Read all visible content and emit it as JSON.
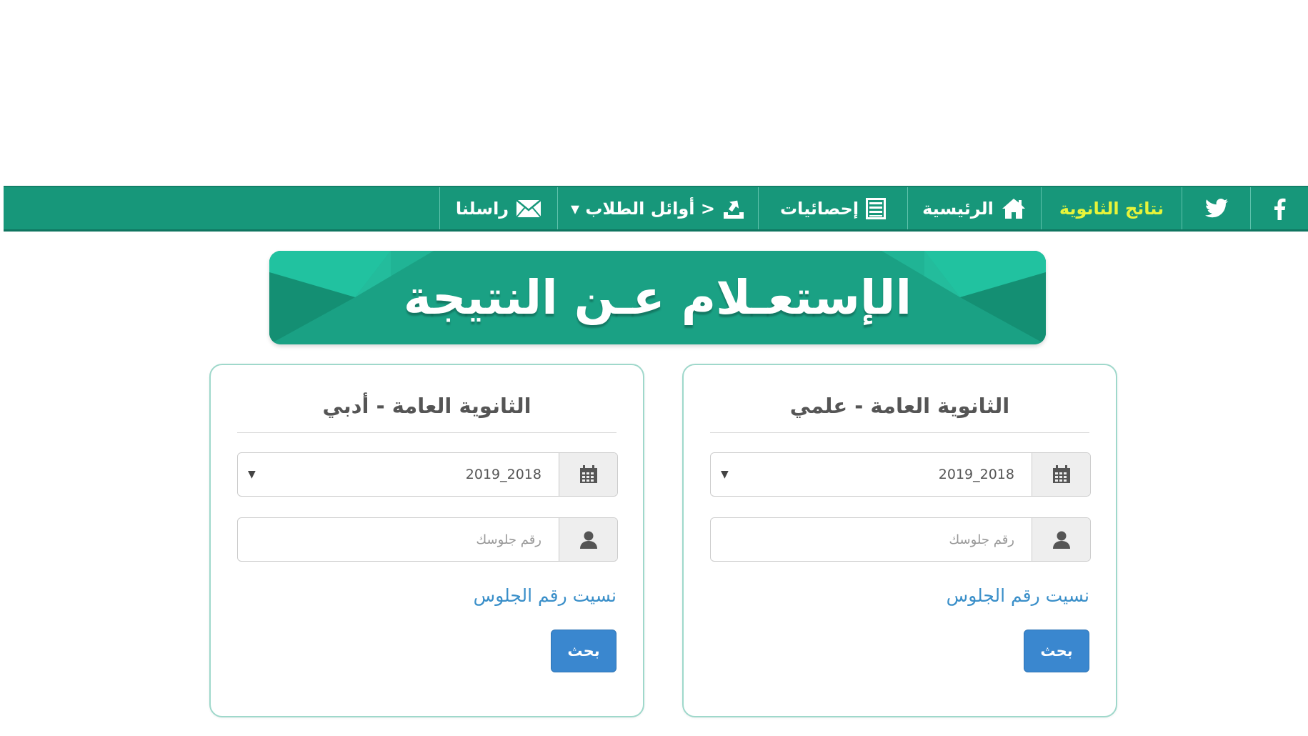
{
  "nav": {
    "facebook_icon": "facebook-icon",
    "twitter_icon": "twitter-icon",
    "brand": "نتائج الثانوية",
    "home": "الرئيسية",
    "stats": "إحصائيات",
    "top_students": "< أوائل الطلاب ▾",
    "contact": "راسلنا"
  },
  "banner": {
    "title": "الإستعـلام عـن النتيجة"
  },
  "cards": [
    {
      "title": "الثانوية العامة - علمي",
      "year_value": "2019_2018",
      "seat_placeholder": "رقم جلوسك",
      "forgot": "نسيت رقم الجلوس",
      "search": "بحث"
    },
    {
      "title": "الثانوية العامة - أدبي",
      "year_value": "2019_2018",
      "seat_placeholder": "رقم جلوسك",
      "forgot": "نسيت رقم الجلوس",
      "search": "بحث"
    }
  ],
  "colors": {
    "nav_bg": "#17977a",
    "brand_text": "#e7f43a",
    "banner_bg": "#1ea687",
    "card_border": "#9fd8cb",
    "link": "#3a8fc9",
    "button": "#3a87cf"
  }
}
